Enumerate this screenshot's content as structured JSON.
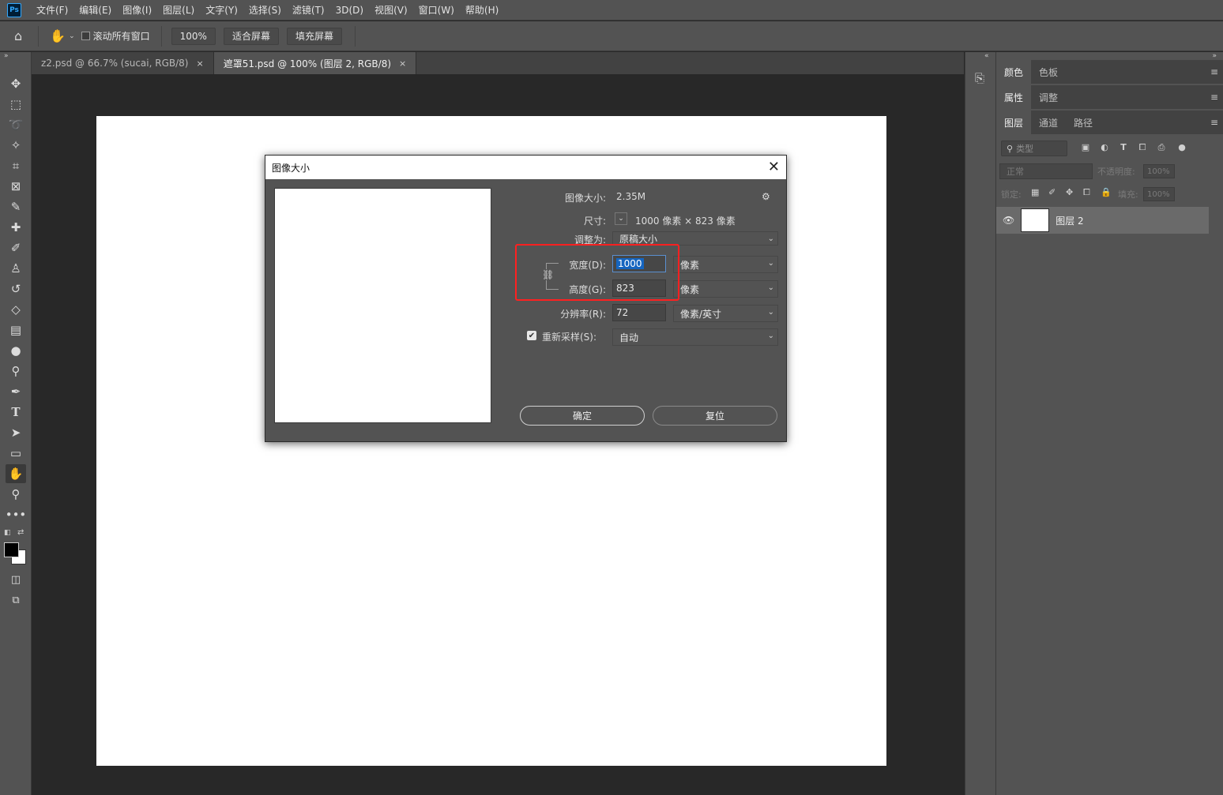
{
  "app": {
    "logo": "Ps"
  },
  "menu": [
    "文件(F)",
    "编辑(E)",
    "图像(I)",
    "图层(L)",
    "文字(Y)",
    "选择(S)",
    "滤镜(T)",
    "3D(D)",
    "视图(V)",
    "窗口(W)",
    "帮助(H)"
  ],
  "options": {
    "scroll_all": "滚动所有窗口",
    "zoom": "100%",
    "fit_screen": "适合屏幕",
    "fill_screen": "填充屏幕"
  },
  "tabs": [
    {
      "label": "z2.psd @ 66.7% (sucai, RGB/8)",
      "close": "×"
    },
    {
      "label": "遮罩51.psd @ 100% (图层 2, RGB/8)",
      "close": "×"
    }
  ],
  "panels": {
    "group1": [
      "颜色",
      "色板"
    ],
    "group2": [
      "属性",
      "调整"
    ],
    "group3": [
      "图层",
      "通道",
      "路径"
    ],
    "filter_placeholder": "类型",
    "blend_mode": "正常",
    "opacity_label": "不透明度:",
    "opacity_value": "100%",
    "lock_label": "锁定:",
    "fill_label": "填充:",
    "fill_value": "100%",
    "layer_name": "图层 2",
    "menu_icon": "≡"
  },
  "dialog": {
    "title": "图像大小",
    "image_size_label": "图像大小:",
    "image_size_value": "2.35M",
    "dimensions_label": "尺寸:",
    "dimensions_value": "1000 像素 × 823 像素",
    "fit_to_label": "调整为:",
    "fit_to_value": "原稿大小",
    "width_label": "宽度(D):",
    "width_value": "1000",
    "width_unit": "像素",
    "height_label": "高度(G):",
    "height_value": "823",
    "height_unit": "像素",
    "resolution_label": "分辨率(R):",
    "resolution_value": "72",
    "resolution_unit": "像素/英寸",
    "resample_label": "重新采样(S):",
    "resample_value": "自动",
    "ok": "确定",
    "reset": "复位"
  },
  "colors": {
    "highlight": "#ff2020",
    "selection": "#1565c0"
  }
}
